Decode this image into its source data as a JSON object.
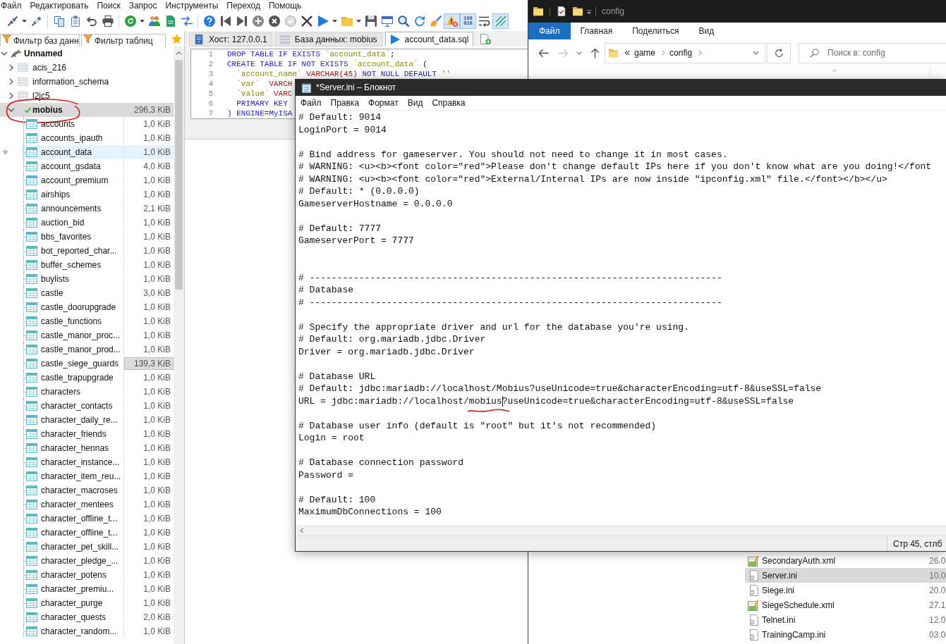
{
  "heidisql": {
    "menu": [
      "Файл",
      "Редактировать",
      "Поиск",
      "Запрос",
      "Инструменты",
      "Переход",
      "Помощь"
    ],
    "toolbar": [
      [
        {
          "on": false,
          "dropdown": true
        },
        {
          "on": false,
          "dropdown": false
        }
      ],
      [
        {
          "on": false,
          "dropdown": false
        },
        {
          "on": false,
          "dropdown": false
        },
        {
          "on": false,
          "dropdown": false
        },
        {
          "on": false,
          "dropdown": false
        }
      ],
      [
        {
          "on": false,
          "dropdown": true
        },
        {
          "on": false,
          "dropdown": false
        },
        {
          "on": false,
          "dropdown": false
        },
        {
          "on": false,
          "dropdown": false
        }
      ],
      [
        {
          "on": false,
          "dropdown": false
        },
        {
          "on": false,
          "dropdown": false
        },
        {
          "on": false,
          "dropdown": false
        },
        {
          "on": false,
          "dropdown": false
        },
        {
          "on": false,
          "dropdown": false
        },
        {
          "on": false,
          "dropdown": false
        },
        {
          "on": false,
          "dropdown": false
        },
        {
          "on": false,
          "dropdown": true
        },
        {
          "on": false,
          "dropdown": true
        },
        {
          "on": false,
          "dropdown": false
        },
        {
          "on": false,
          "dropdown": false
        },
        {
          "on": false,
          "dropdown": false
        },
        {
          "on": false,
          "dropdown": false
        },
        {
          "on": false,
          "dropdown": false
        },
        {
          "on": true,
          "dropdown": false
        },
        {
          "on": true,
          "dropdown": false,
          "label_lines": [
            "100",
            "010"
          ]
        },
        {
          "on": false,
          "dropdown": false
        },
        {
          "on": true,
          "dropdown": false
        }
      ]
    ],
    "filters": [
      {
        "placeholder": "Фильтр баз данн"
      },
      {
        "placeholder": "Фильтр таблиц"
      }
    ],
    "tabs": [
      {
        "label": "Хост: 127.0.0.1",
        "kind": "host",
        "selected": false
      },
      {
        "label": "База данных: mobius",
        "kind": "database",
        "selected": false
      },
      {
        "label": "account_data.sql",
        "kind": "query",
        "selected": true
      }
    ],
    "tree": {
      "name": "Unnamed",
      "expanded": true,
      "children": [
        {
          "name": "acis_216",
          "expanded": false,
          "selected": false
        },
        {
          "name": "information_schema",
          "expanded": false,
          "selected": false
        },
        {
          "name": "l2jc5",
          "expanded": false,
          "selected": false
        },
        {
          "name": "mobius",
          "size": "296,3 KiB",
          "expanded": true,
          "selected": true,
          "circled": true,
          "children": [
            {
              "name": "accounts",
              "size": "1,0 KiB",
              "hovered": false
            },
            {
              "name": "accounts_ipauth",
              "size": "1,0 KiB",
              "hovered": false
            },
            {
              "name": "account_data",
              "size": "1,0 KiB",
              "hovered": true
            },
            {
              "name": "account_gsdata",
              "size": "4,0 KiB",
              "hovered": false
            },
            {
              "name": "account_premium",
              "size": "1,0 KiB",
              "hovered": false
            },
            {
              "name": "airships",
              "size": "1,0 KiB",
              "hovered": false
            },
            {
              "name": "announcements",
              "size": "2,1 KiB",
              "hovered": false
            },
            {
              "name": "auction_bid",
              "size": "1,0 KiB",
              "hovered": false
            },
            {
              "name": "bbs_favorites",
              "size": "1,0 KiB",
              "hovered": false
            },
            {
              "name": "bot_reported_char...",
              "size": "1,0 KiB",
              "hovered": false
            },
            {
              "name": "buffer_schemes",
              "size": "1,0 KiB",
              "hovered": false
            },
            {
              "name": "buylists",
              "size": "1,0 KiB",
              "hovered": false
            },
            {
              "name": "castle",
              "size": "3,0 KiB",
              "hovered": false
            },
            {
              "name": "castle_doorupgrade",
              "size": "1,0 KiB",
              "hovered": false
            },
            {
              "name": "castle_functions",
              "size": "1,0 KiB",
              "hovered": false
            },
            {
              "name": "castle_manor_proc...",
              "size": "1,0 KiB",
              "hovered": false
            },
            {
              "name": "castle_manor_prod...",
              "size": "1,0 KiB",
              "hovered": false
            },
            {
              "name": "castle_siege_guards",
              "size": "139,3 KiB",
              "level": 1,
              "hovered": false
            },
            {
              "name": "castle_trapupgrade",
              "size": "1,0 KiB",
              "hovered": false
            },
            {
              "name": "characters",
              "size": "1,0 KiB",
              "hovered": false
            },
            {
              "name": "character_contacts",
              "size": "1,0 KiB",
              "hovered": false
            },
            {
              "name": "character_daily_re...",
              "size": "1,0 KiB",
              "hovered": false
            },
            {
              "name": "character_friends",
              "size": "1,0 KiB",
              "hovered": false
            },
            {
              "name": "character_hennas",
              "size": "1,0 KiB",
              "hovered": false
            },
            {
              "name": "character_instance...",
              "size": "1,0 KiB",
              "hovered": false
            },
            {
              "name": "character_item_reu...",
              "size": "1,0 KiB",
              "hovered": false
            },
            {
              "name": "character_macroses",
              "size": "1,0 KiB",
              "hovered": false
            },
            {
              "name": "character_mentees",
              "size": "1,0 KiB",
              "hovered": false
            },
            {
              "name": "character_offline_t...",
              "size": "1,0 KiB",
              "hovered": false
            },
            {
              "name": "character_offline_t...",
              "size": "1,0 KiB",
              "hovered": false
            },
            {
              "name": "character_pet_skill...",
              "size": "1,0 KiB",
              "hovered": false
            },
            {
              "name": "character_pledge_...",
              "size": "1,0 KiB",
              "hovered": false
            },
            {
              "name": "character_potens",
              "size": "1,0 KiB",
              "hovered": false
            },
            {
              "name": "character_premiu...",
              "size": "1,0 KiB",
              "hovered": false
            },
            {
              "name": "character_purge",
              "size": "1,0 KiB",
              "hovered": false
            },
            {
              "name": "character_quests",
              "size": "2,0 KiB",
              "hovered": false
            },
            {
              "name": "character_random...",
              "size": "1,0 KiB",
              "hovered": false
            }
          ]
        }
      ]
    },
    "editor": {
      "lines": [
        {
          "number": "1",
          "indented": false,
          "tokens": [
            {
              "text": "DROP TABLE IF EXISTS ",
              "kind": "keyword"
            },
            {
              "text": "`account_data`",
              "kind": "identifier"
            },
            {
              "text": ";",
              "kind": "plain"
            }
          ]
        },
        {
          "number": "2",
          "indented": false,
          "tokens": [
            {
              "text": "CREATE TABLE IF NOT EXISTS ",
              "kind": "keyword"
            },
            {
              "text": "`account_data`",
              "kind": "identifier"
            },
            {
              "text": " (",
              "kind": "plain"
            }
          ]
        },
        {
          "number": "3",
          "indented": true,
          "tokens": [
            {
              "text": "`account_name`",
              "kind": "identifier"
            },
            {
              "text": " VARCHAR(45)",
              "kind": "type"
            },
            {
              "text": " NOT NULL DEFAULT ",
              "kind": "keyword"
            },
            {
              "text": "''",
              "kind": "identifier"
            }
          ]
        },
        {
          "number": "4",
          "indented": true,
          "tokens": [
            {
              "text": "`var`",
              "kind": "identifier"
            },
            {
              "text": "  VARCH",
              "kind": "type"
            }
          ]
        },
        {
          "number": "5",
          "indented": true,
          "tokens": [
            {
              "text": "`value`",
              "kind": "identifier"
            },
            {
              "text": " VARC",
              "kind": "type"
            }
          ]
        },
        {
          "number": "6",
          "indented": true,
          "tokens": [
            {
              "text": "PRIMARY KEY",
              "kind": "keyword"
            }
          ]
        },
        {
          "number": "7",
          "indented": false,
          "tokens": [
            {
              "text": ") ENGINE=MyISA",
              "kind": "keyword"
            }
          ]
        }
      ]
    }
  },
  "explorer": {
    "title": "config",
    "ribbon": [
      {
        "label": "Файл",
        "kind": "menu"
      },
      {
        "label": "Главная",
        "kind": "tab"
      },
      {
        "label": "Поделиться",
        "kind": "tab"
      },
      {
        "label": "Вид",
        "kind": "tab"
      }
    ],
    "nav": {
      "back_disabled": false,
      "forward_disabled": true
    },
    "breadcrumbs": [
      "game",
      "config"
    ],
    "search": {
      "placeholder": "Поиск в: config"
    },
    "files": [
      {
        "name": "SecondaryAuth.xml",
        "date": "26.0",
        "kind": "xml",
        "selected": false
      },
      {
        "name": "Server.ini",
        "date": "10.0",
        "kind": "ini",
        "selected": true
      },
      {
        "name": "Siege.ini",
        "date": "20.0",
        "kind": "ini",
        "selected": false
      },
      {
        "name": "SiegeSchedule.xml",
        "date": "27.1",
        "kind": "xml",
        "selected": false
      },
      {
        "name": "Telnet.ini",
        "date": "12.0",
        "kind": "ini",
        "selected": false
      },
      {
        "name": "TrainingCamp.ini",
        "date": "03.0",
        "kind": "ini",
        "selected": false
      }
    ]
  },
  "notepad": {
    "title": "*Server.ini – Блокнот",
    "menu": [
      "Файл",
      "Правка",
      "Формат",
      "Вид",
      "Справка"
    ],
    "lines": [
      {
        "kind": "text",
        "text": "# Default: 9014"
      },
      {
        "kind": "text",
        "text": "LoginPort = 9014"
      },
      {
        "kind": "blank"
      },
      {
        "kind": "text",
        "text": "# Bind address for gameserver. You should not need to change it in most cases."
      },
      {
        "kind": "text",
        "text": "# WARNING: <u><b><font color=\"red\">Please don't change default IPs here if you don't know what are you doing!</font"
      },
      {
        "kind": "text",
        "text": "# WARNING: <u><b><font color=\"red\">External/Internal IPs are now inside \"ipconfig.xml\" file.</font></b></u>"
      },
      {
        "kind": "text",
        "text": "# Default: * (0.0.0.0)"
      },
      {
        "kind": "text",
        "text": "GameserverHostname = 0.0.0.0"
      },
      {
        "kind": "blank"
      },
      {
        "kind": "text",
        "text": "# Default: 7777"
      },
      {
        "kind": "text",
        "text": "GameserverPort = 7777"
      },
      {
        "kind": "blank"
      },
      {
        "kind": "blank"
      },
      {
        "kind": "text",
        "text": "# ---------------------------------------------------------------------------"
      },
      {
        "kind": "text",
        "text": "# Database"
      },
      {
        "kind": "text",
        "text": "# ---------------------------------------------------------------------------"
      },
      {
        "kind": "blank"
      },
      {
        "kind": "text",
        "text": "# Specify the appropriate driver and url for the database you're using."
      },
      {
        "kind": "text",
        "text": "# Default: org.mariadb.jdbc.Driver"
      },
      {
        "kind": "text",
        "text": "Driver = org.mariadb.jdbc.Driver"
      },
      {
        "kind": "blank"
      },
      {
        "kind": "text",
        "text": "# Database URL"
      },
      {
        "kind": "text",
        "text": "# Default: jdbc:mariadb://localhost/Mobius?useUnicode=true&characterEncoding=utf-8&useSSL=false"
      },
      {
        "kind": "marked",
        "segments": [
          {
            "text": "URL = jdbc:mariadb://localhost/",
            "underlined": false,
            "caret_after": false
          },
          {
            "text": "mobius",
            "underlined": true,
            "caret_after": true
          },
          {
            "text": "?useUnicode=true&characterEncoding=utf-8&useSSL=false",
            "underlined": false,
            "caret_after": false
          }
        ]
      },
      {
        "kind": "blank"
      },
      {
        "kind": "text",
        "text": "# Database user info (default is \"root\" but it's not recommended)"
      },
      {
        "kind": "text",
        "text": "Login = root"
      },
      {
        "kind": "blank"
      },
      {
        "kind": "text",
        "text": "# Database connection password"
      },
      {
        "kind": "text",
        "text": "Password ="
      },
      {
        "kind": "blank"
      },
      {
        "kind": "text",
        "text": "# Default: 100"
      },
      {
        "kind": "text",
        "text": "MaximumDbConnections = 100"
      }
    ],
    "status": "Стр 45, стлб"
  }
}
